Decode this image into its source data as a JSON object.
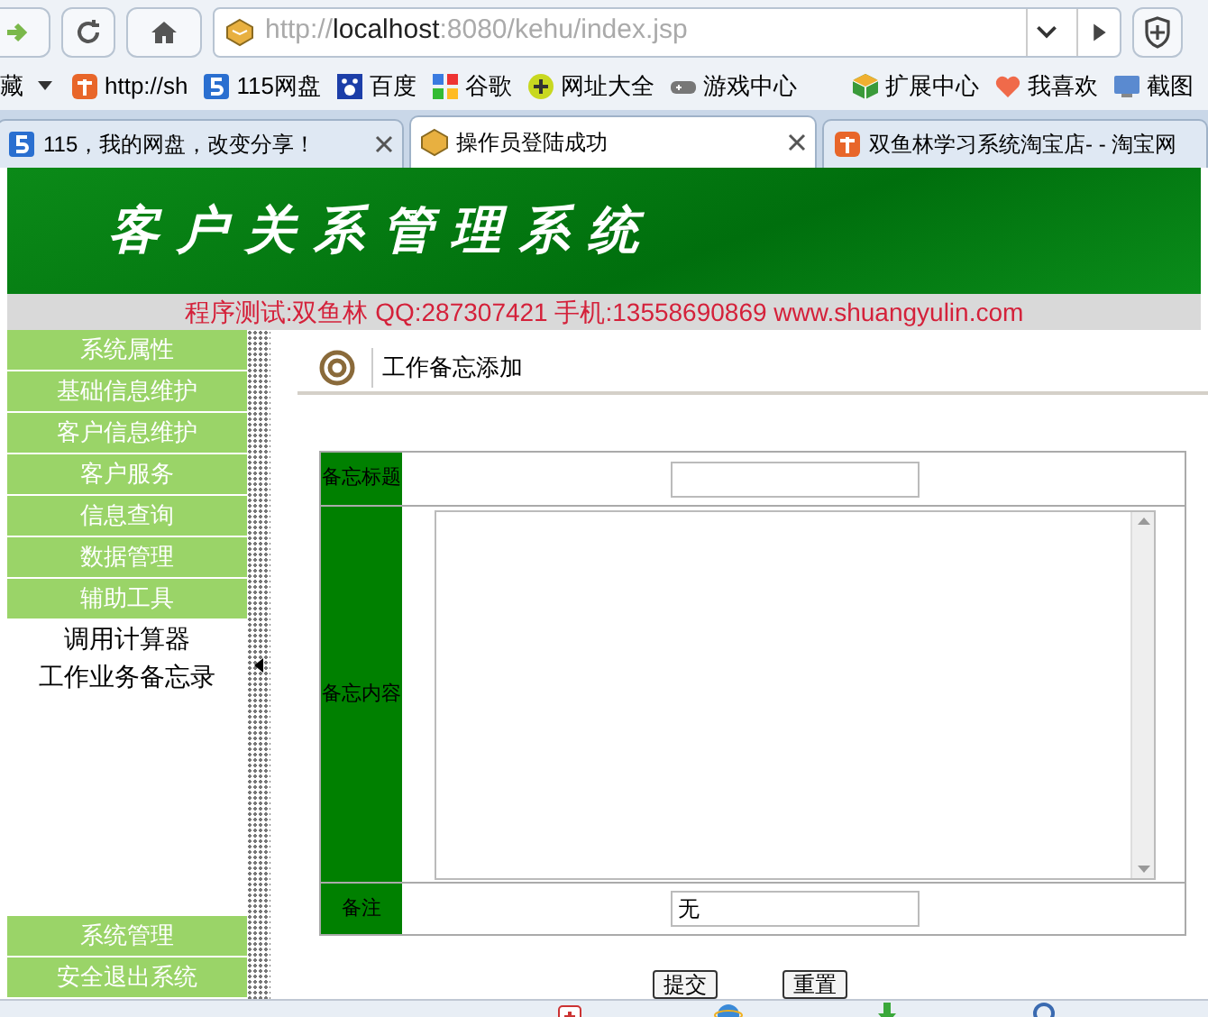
{
  "address_bar": {
    "scheme": "http://",
    "host": "localhost",
    "path": ":8080/kehu/index.jsp"
  },
  "bookmarks_left": [
    {
      "label": "藏"
    },
    {
      "label": "http://sh"
    },
    {
      "label": "115网盘"
    },
    {
      "label": "百度"
    },
    {
      "label": "谷歌"
    },
    {
      "label": "网址大全"
    },
    {
      "label": "游戏中心"
    }
  ],
  "bookmarks_right": [
    {
      "label": "扩展中心"
    },
    {
      "label": "我喜欢"
    },
    {
      "label": "截图"
    }
  ],
  "tabs": [
    {
      "label": "115，我的网盘，改变分享！",
      "selected": false,
      "closable": true
    },
    {
      "label": "操作员登陆成功",
      "selected": true,
      "closable": true
    },
    {
      "label": "双鱼林学习系统淘宝店- - 淘宝网",
      "selected": false,
      "closable": false
    }
  ],
  "banner": {
    "title": "客户关系管理系统"
  },
  "info_line": "程序测试:双鱼林 QQ:287307421 手机:13558690869 www.shuangyulin.com",
  "menu": [
    {
      "label": "系统属性",
      "kind": "header"
    },
    {
      "label": "基础信息维护",
      "kind": "header"
    },
    {
      "label": "客户信息维护",
      "kind": "header"
    },
    {
      "label": "客户服务",
      "kind": "header"
    },
    {
      "label": "信息查询",
      "kind": "header"
    },
    {
      "label": "数据管理",
      "kind": "header"
    },
    {
      "label": "辅助工具",
      "kind": "header"
    },
    {
      "label": "调用计算器",
      "kind": "link"
    },
    {
      "label": "工作业务备忘录",
      "kind": "link"
    },
    {
      "label": "系统管理",
      "kind": "footer"
    },
    {
      "label": "安全退出系统",
      "kind": "footer"
    }
  ],
  "content": {
    "title": "工作备忘添加",
    "form": [
      {
        "label": "备忘标题",
        "kind": "text"
      },
      {
        "label": "备忘内容",
        "kind": "textarea"
      },
      {
        "label": "备注",
        "kind": "text",
        "value": "无"
      }
    ],
    "buttons": [
      "提交",
      "重置"
    ]
  }
}
